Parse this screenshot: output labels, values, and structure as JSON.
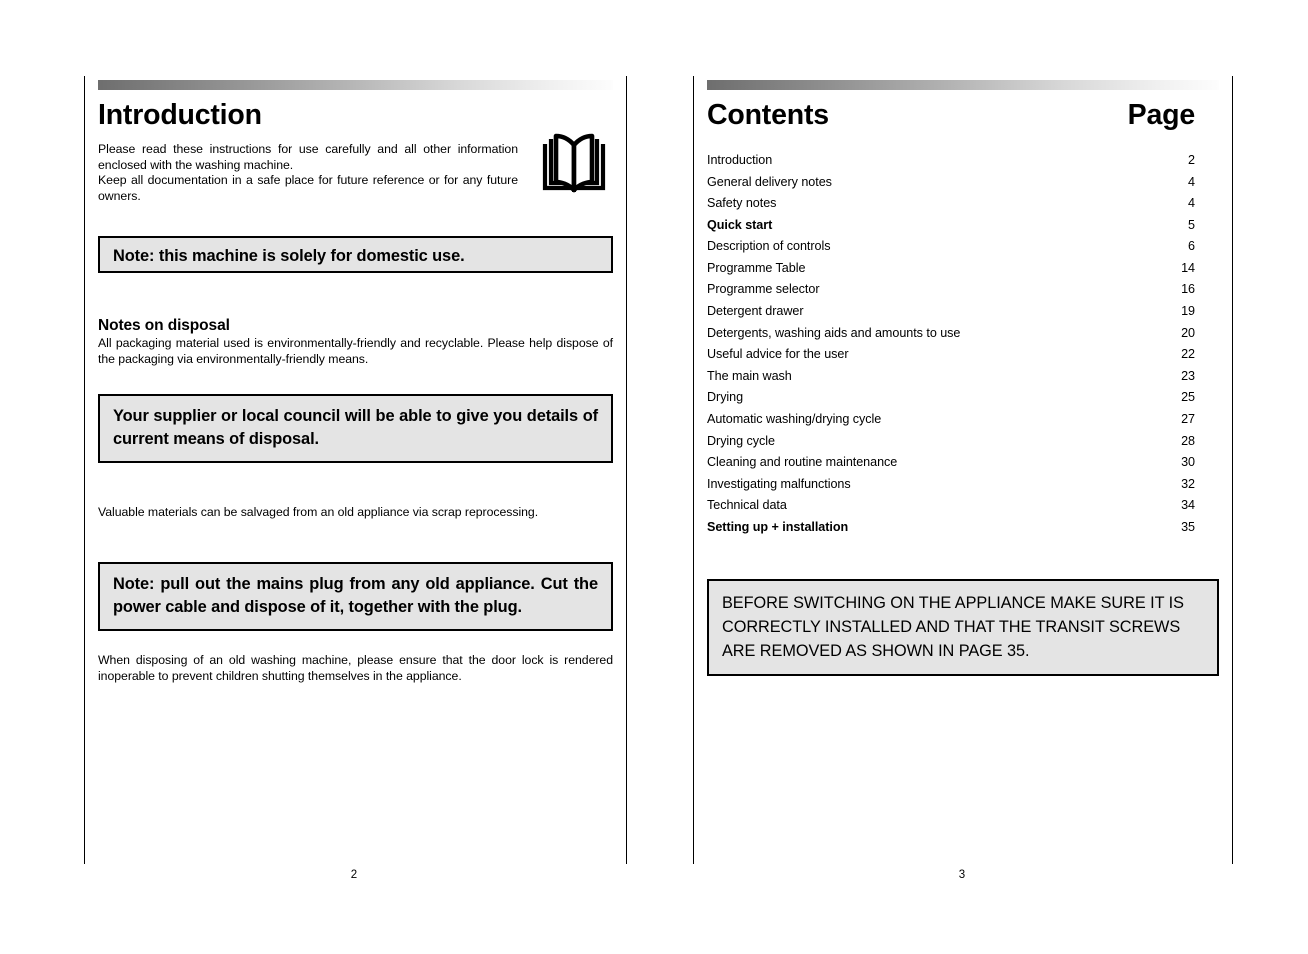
{
  "document": {
    "type": "appliance-instruction-manual-spread"
  },
  "colors": {
    "callout_fill": "#e4e4e4",
    "callout_border": "#000000",
    "gradient_start": "#6e6e6e",
    "gradient_end": "#ffffff",
    "text": "#000000"
  },
  "left_page": {
    "folio": "2",
    "title": "Introduction",
    "intro_paragraph": "Please read these instructions for use carefully and all other information enclosed with the washing machine.\nKeep all documentation in a safe place for future reference or for any future owners.",
    "intro_line_1": "Please read these instructions for use carefully and all other information enclosed with the washing machine.",
    "intro_line_2": "Keep all documentation in a safe place for future reference or for any future owners.",
    "icon": "open-book-icon",
    "note_domestic": "Note: this machine is solely for domestic use.",
    "disposal_heading": "Notes on disposal",
    "disposal_paragraph": "All packaging material used is environmentally-friendly and recyclable. Please help dispose of the packaging via environmentally-friendly means.",
    "note_supplier": "Your supplier or local council will be able to give you details of current means of disposal.",
    "salvage_paragraph": "Valuable materials can be salvaged from an old appliance via scrap reprocessing.",
    "note_plug": "Note: pull out the mains plug from any old appliance. Cut the power cable and dispose of it, together with the plug.",
    "door_lock_paragraph": "When disposing of an old washing machine, please ensure that the door lock is rendered inoperable to prevent children shutting themselves in the appliance."
  },
  "right_page": {
    "folio": "3",
    "title": "Contents",
    "page_column_header": "Page",
    "entries": [
      {
        "label": "Introduction",
        "page": "2",
        "bold": false
      },
      {
        "label": "General delivery notes",
        "page": "4",
        "bold": false
      },
      {
        "label": "Safety notes",
        "page": "4",
        "bold": false
      },
      {
        "label": "Quick start",
        "page": "5",
        "bold": true
      },
      {
        "label": "Description of controls",
        "page": "6",
        "bold": false
      },
      {
        "label": "Programme Table",
        "page": "14",
        "bold": false
      },
      {
        "label": "Programme selector",
        "page": "16",
        "bold": false
      },
      {
        "label": "Detergent drawer",
        "page": "19",
        "bold": false
      },
      {
        "label": "Detergents, washing aids and amounts to use",
        "page": "20",
        "bold": false
      },
      {
        "label": "Useful advice for the user",
        "page": "22",
        "bold": false
      },
      {
        "label": "The main wash",
        "page": "23",
        "bold": false
      },
      {
        "label": "Drying",
        "page": "25",
        "bold": false
      },
      {
        "label": "Automatic washing/drying cycle",
        "page": "27",
        "bold": false
      },
      {
        "label": "Drying cycle",
        "page": "28",
        "bold": false
      },
      {
        "label": "Cleaning and routine maintenance",
        "page": "30",
        "bold": false
      },
      {
        "label": "Investigating malfunctions",
        "page": "32",
        "bold": false
      },
      {
        "label": "Technical data",
        "page": "34",
        "bold": false
      },
      {
        "label": "Setting up +  installation",
        "page": "35",
        "bold": true
      }
    ],
    "transit_warning": "BEFORE SWITCHING ON THE APPLIANCE MAKE SURE IT IS CORRECTLY INSTALLED AND THAT THE TRANSIT SCREWS ARE REMOVED AS SHOWN IN PAGE 35."
  }
}
